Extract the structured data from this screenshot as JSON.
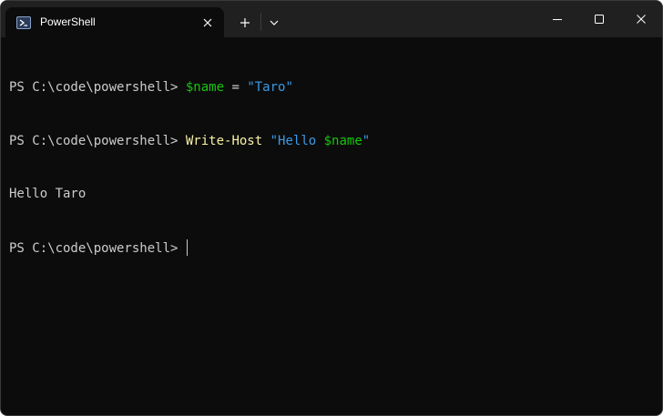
{
  "window": {
    "tab_title": "PowerShell",
    "tab_icon": "powershell-icon",
    "new_tab_icon": "plus-icon",
    "dropdown_icon": "chevron-down-icon",
    "controls": [
      "minimize-icon",
      "maximize-icon",
      "close-icon"
    ]
  },
  "terminal": {
    "colors": {
      "background": "#0c0c0c",
      "foreground": "#cccccc",
      "variable": "#16c60c",
      "string": "#3b9ae6",
      "command": "#f9f1a5"
    },
    "lines": [
      {
        "prompt": "PS C:\\code\\powershell> ",
        "var": "$name",
        "op": " = ",
        "str": "\"Taro\""
      },
      {
        "prompt": "PS C:\\code\\powershell> ",
        "cmd": "Write-Host",
        "space": " ",
        "str_open": "\"Hello ",
        "str_var": "$name",
        "str_close": "\""
      },
      {
        "output": "Hello Taro"
      },
      {
        "prompt": "PS C:\\code\\powershell> "
      }
    ]
  }
}
